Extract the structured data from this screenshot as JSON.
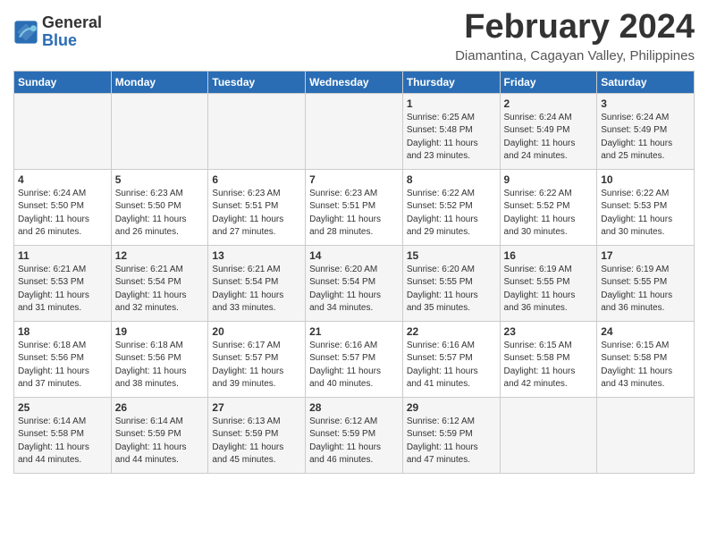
{
  "header": {
    "logo_general": "General",
    "logo_blue": "Blue",
    "month_title": "February 2024",
    "location": "Diamantina, Cagayan Valley, Philippines"
  },
  "days_of_week": [
    "Sunday",
    "Monday",
    "Tuesday",
    "Wednesday",
    "Thursday",
    "Friday",
    "Saturday"
  ],
  "weeks": [
    [
      {
        "day": "",
        "info": ""
      },
      {
        "day": "",
        "info": ""
      },
      {
        "day": "",
        "info": ""
      },
      {
        "day": "",
        "info": ""
      },
      {
        "day": "1",
        "info": "Sunrise: 6:25 AM\nSunset: 5:48 PM\nDaylight: 11 hours\nand 23 minutes."
      },
      {
        "day": "2",
        "info": "Sunrise: 6:24 AM\nSunset: 5:49 PM\nDaylight: 11 hours\nand 24 minutes."
      },
      {
        "day": "3",
        "info": "Sunrise: 6:24 AM\nSunset: 5:49 PM\nDaylight: 11 hours\nand 25 minutes."
      }
    ],
    [
      {
        "day": "4",
        "info": "Sunrise: 6:24 AM\nSunset: 5:50 PM\nDaylight: 11 hours\nand 26 minutes."
      },
      {
        "day": "5",
        "info": "Sunrise: 6:23 AM\nSunset: 5:50 PM\nDaylight: 11 hours\nand 26 minutes."
      },
      {
        "day": "6",
        "info": "Sunrise: 6:23 AM\nSunset: 5:51 PM\nDaylight: 11 hours\nand 27 minutes."
      },
      {
        "day": "7",
        "info": "Sunrise: 6:23 AM\nSunset: 5:51 PM\nDaylight: 11 hours\nand 28 minutes."
      },
      {
        "day": "8",
        "info": "Sunrise: 6:22 AM\nSunset: 5:52 PM\nDaylight: 11 hours\nand 29 minutes."
      },
      {
        "day": "9",
        "info": "Sunrise: 6:22 AM\nSunset: 5:52 PM\nDaylight: 11 hours\nand 30 minutes."
      },
      {
        "day": "10",
        "info": "Sunrise: 6:22 AM\nSunset: 5:53 PM\nDaylight: 11 hours\nand 30 minutes."
      }
    ],
    [
      {
        "day": "11",
        "info": "Sunrise: 6:21 AM\nSunset: 5:53 PM\nDaylight: 11 hours\nand 31 minutes."
      },
      {
        "day": "12",
        "info": "Sunrise: 6:21 AM\nSunset: 5:54 PM\nDaylight: 11 hours\nand 32 minutes."
      },
      {
        "day": "13",
        "info": "Sunrise: 6:21 AM\nSunset: 5:54 PM\nDaylight: 11 hours\nand 33 minutes."
      },
      {
        "day": "14",
        "info": "Sunrise: 6:20 AM\nSunset: 5:54 PM\nDaylight: 11 hours\nand 34 minutes."
      },
      {
        "day": "15",
        "info": "Sunrise: 6:20 AM\nSunset: 5:55 PM\nDaylight: 11 hours\nand 35 minutes."
      },
      {
        "day": "16",
        "info": "Sunrise: 6:19 AM\nSunset: 5:55 PM\nDaylight: 11 hours\nand 36 minutes."
      },
      {
        "day": "17",
        "info": "Sunrise: 6:19 AM\nSunset: 5:55 PM\nDaylight: 11 hours\nand 36 minutes."
      }
    ],
    [
      {
        "day": "18",
        "info": "Sunrise: 6:18 AM\nSunset: 5:56 PM\nDaylight: 11 hours\nand 37 minutes."
      },
      {
        "day": "19",
        "info": "Sunrise: 6:18 AM\nSunset: 5:56 PM\nDaylight: 11 hours\nand 38 minutes."
      },
      {
        "day": "20",
        "info": "Sunrise: 6:17 AM\nSunset: 5:57 PM\nDaylight: 11 hours\nand 39 minutes."
      },
      {
        "day": "21",
        "info": "Sunrise: 6:16 AM\nSunset: 5:57 PM\nDaylight: 11 hours\nand 40 minutes."
      },
      {
        "day": "22",
        "info": "Sunrise: 6:16 AM\nSunset: 5:57 PM\nDaylight: 11 hours\nand 41 minutes."
      },
      {
        "day": "23",
        "info": "Sunrise: 6:15 AM\nSunset: 5:58 PM\nDaylight: 11 hours\nand 42 minutes."
      },
      {
        "day": "24",
        "info": "Sunrise: 6:15 AM\nSunset: 5:58 PM\nDaylight: 11 hours\nand 43 minutes."
      }
    ],
    [
      {
        "day": "25",
        "info": "Sunrise: 6:14 AM\nSunset: 5:58 PM\nDaylight: 11 hours\nand 44 minutes."
      },
      {
        "day": "26",
        "info": "Sunrise: 6:14 AM\nSunset: 5:59 PM\nDaylight: 11 hours\nand 44 minutes."
      },
      {
        "day": "27",
        "info": "Sunrise: 6:13 AM\nSunset: 5:59 PM\nDaylight: 11 hours\nand 45 minutes."
      },
      {
        "day": "28",
        "info": "Sunrise: 6:12 AM\nSunset: 5:59 PM\nDaylight: 11 hours\nand 46 minutes."
      },
      {
        "day": "29",
        "info": "Sunrise: 6:12 AM\nSunset: 5:59 PM\nDaylight: 11 hours\nand 47 minutes."
      },
      {
        "day": "",
        "info": ""
      },
      {
        "day": "",
        "info": ""
      }
    ]
  ]
}
